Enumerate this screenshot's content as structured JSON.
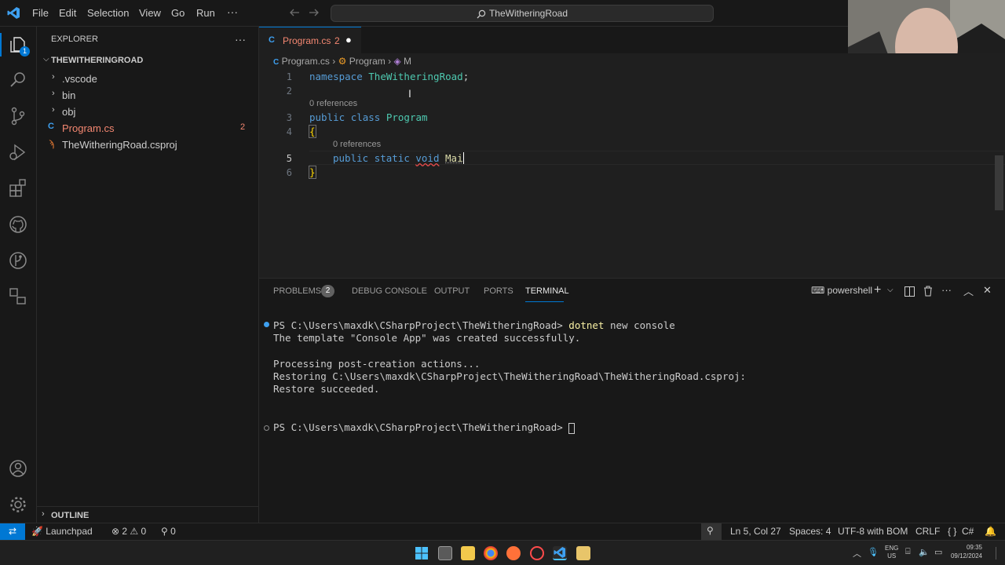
{
  "titlebar": {
    "menus": [
      "File",
      "Edit",
      "Selection",
      "View",
      "Go",
      "Run"
    ],
    "more": "···",
    "search_title": "TheWitheringRoad"
  },
  "activity_bar": {
    "explorer_badge": "1",
    "icons": [
      "explorer-icon",
      "search-icon",
      "source-control-icon",
      "run-debug-icon",
      "extensions-icon",
      "github-icon",
      "gitlens-icon",
      "remote-explorer-icon",
      "account-icon",
      "settings-gear-icon"
    ]
  },
  "sidebar": {
    "title": "EXPLORER",
    "more": "···",
    "root": "THEWITHERINGROAD",
    "items": [
      {
        "label": ".vscode",
        "type": "folder"
      },
      {
        "label": "bin",
        "type": "folder"
      },
      {
        "label": "obj",
        "type": "folder"
      },
      {
        "label": "Program.cs",
        "type": "file",
        "badge": "2"
      },
      {
        "label": "TheWitheringRoad.csproj",
        "type": "file"
      }
    ],
    "outline": "OUTLINE"
  },
  "editor": {
    "tab": {
      "label": "Program.cs",
      "problems": "2",
      "modified_dot": "●"
    },
    "breadcrumb": [
      "Program.cs",
      "Program",
      "M"
    ],
    "lines": [
      {
        "num": "1",
        "tokens": [
          "namespace",
          " ",
          "TheWitheringRoad",
          ";"
        ]
      },
      {
        "num": "2",
        "tokens": []
      },
      {
        "num": "3",
        "lens": "0 references",
        "tokens": [
          "public",
          " ",
          "class",
          " ",
          "Program"
        ]
      },
      {
        "num": "4",
        "tokens": [
          "{"
        ]
      },
      {
        "num": "5",
        "lens": "0 references",
        "tokens": [
          "public",
          " ",
          "static",
          " ",
          "void",
          " ",
          "Mai"
        ]
      },
      {
        "num": "6",
        "tokens": [
          "}"
        ]
      }
    ]
  },
  "panel": {
    "tabs": [
      "PROBLEMS",
      "DEBUG CONSOLE",
      "OUTPUT",
      "PORTS",
      "TERMINAL"
    ],
    "problems_count": "2",
    "active_tab": "TERMINAL",
    "shell": "powershell",
    "terminal_lines": [
      {
        "prompt": "PS C:\\Users\\maxdk\\CSharpProject\\TheWitheringRoad>",
        "cmd": "dotnet",
        "args": " new console"
      },
      {
        "text": "The template \"Console App\" was created successfully."
      },
      {
        "text": ""
      },
      {
        "text": "Processing post-creation actions..."
      },
      {
        "text": "Restoring C:\\Users\\maxdk\\CSharpProject\\TheWitheringRoad\\TheWitheringRoad.csproj:"
      },
      {
        "text": "Restore succeeded."
      },
      {
        "text": ""
      },
      {
        "text": ""
      },
      {
        "prompt": "PS C:\\Users\\maxdk\\CSharpProject\\TheWitheringRoad>",
        "cmd": "",
        "args": ""
      }
    ]
  },
  "statusbar": {
    "remote": "⇄",
    "launchpad": "Launchpad",
    "errors": "2",
    "warnings": "0",
    "ports": "0",
    "position": "Ln 5, Col 27",
    "spaces": "Spaces: 4",
    "encoding": "UTF-8 with BOM",
    "eol": "CRLF",
    "braces": "{ }",
    "language": "C#"
  },
  "taskbar": {
    "lang_top": "ENG",
    "lang_bottom": "US",
    "time": "09:35",
    "date": "09/12/2024"
  },
  "colors": {
    "accent": "#0078d4",
    "keyword": "#569cd6",
    "type": "#4ec9b0",
    "error": "#f48771",
    "remote_bg": "#0078d4"
  }
}
